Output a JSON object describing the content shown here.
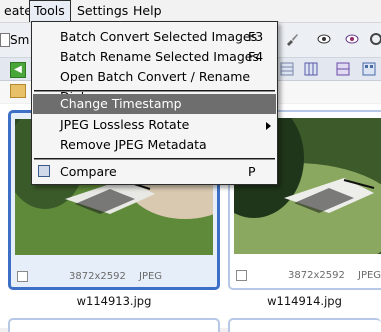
{
  "menubar": {
    "items": [
      "eate",
      "Tools",
      "Settings",
      "Help"
    ],
    "active": "Tools"
  },
  "toolbar": {
    "small_label": "Sm"
  },
  "tools_menu": {
    "items": [
      {
        "label": "Batch Convert Selected Images",
        "shortcut": "F3"
      },
      {
        "label": "Batch Rename Selected Images",
        "shortcut": "F4"
      },
      {
        "label": "Open Batch Convert / Rename Dialog",
        "shortcut": ""
      },
      {
        "label": "Change Timestamp",
        "shortcut": "",
        "highlighted": true
      },
      {
        "label": "JPEG Lossless Rotate",
        "shortcut": "",
        "submenu": true
      },
      {
        "label": "Remove JPEG Metadata",
        "shortcut": ""
      },
      {
        "label": "Compare",
        "shortcut": "P"
      }
    ]
  },
  "thumbnails": [
    {
      "filename": "w114913.jpg",
      "dimensions": "3872x2592",
      "format": "JPEG",
      "selected": true
    },
    {
      "filename": "w114914.jpg",
      "dimensions": "3872x2592",
      "format": "JPEG",
      "selected": false
    }
  ],
  "colors": {
    "selection_border": "#3d6fc7",
    "menu_highlight": "#6e6e6e"
  }
}
